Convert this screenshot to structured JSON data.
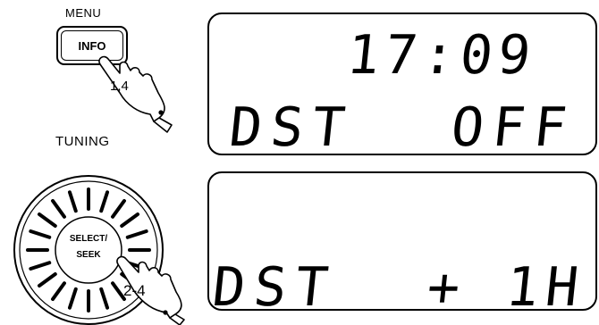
{
  "controls": {
    "menu_label": "MENU",
    "info_button": "INFO",
    "info_step": "1,4",
    "tuning_label": "TUNING",
    "knob_center_line1": "SELECT/",
    "knob_center_line2": "SEEK",
    "knob_step": "2-4"
  },
  "display_1": {
    "time": "17:09",
    "setting": "DST",
    "value": "OFF"
  },
  "display_2": {
    "setting": "DST",
    "value": "+ 1H"
  }
}
